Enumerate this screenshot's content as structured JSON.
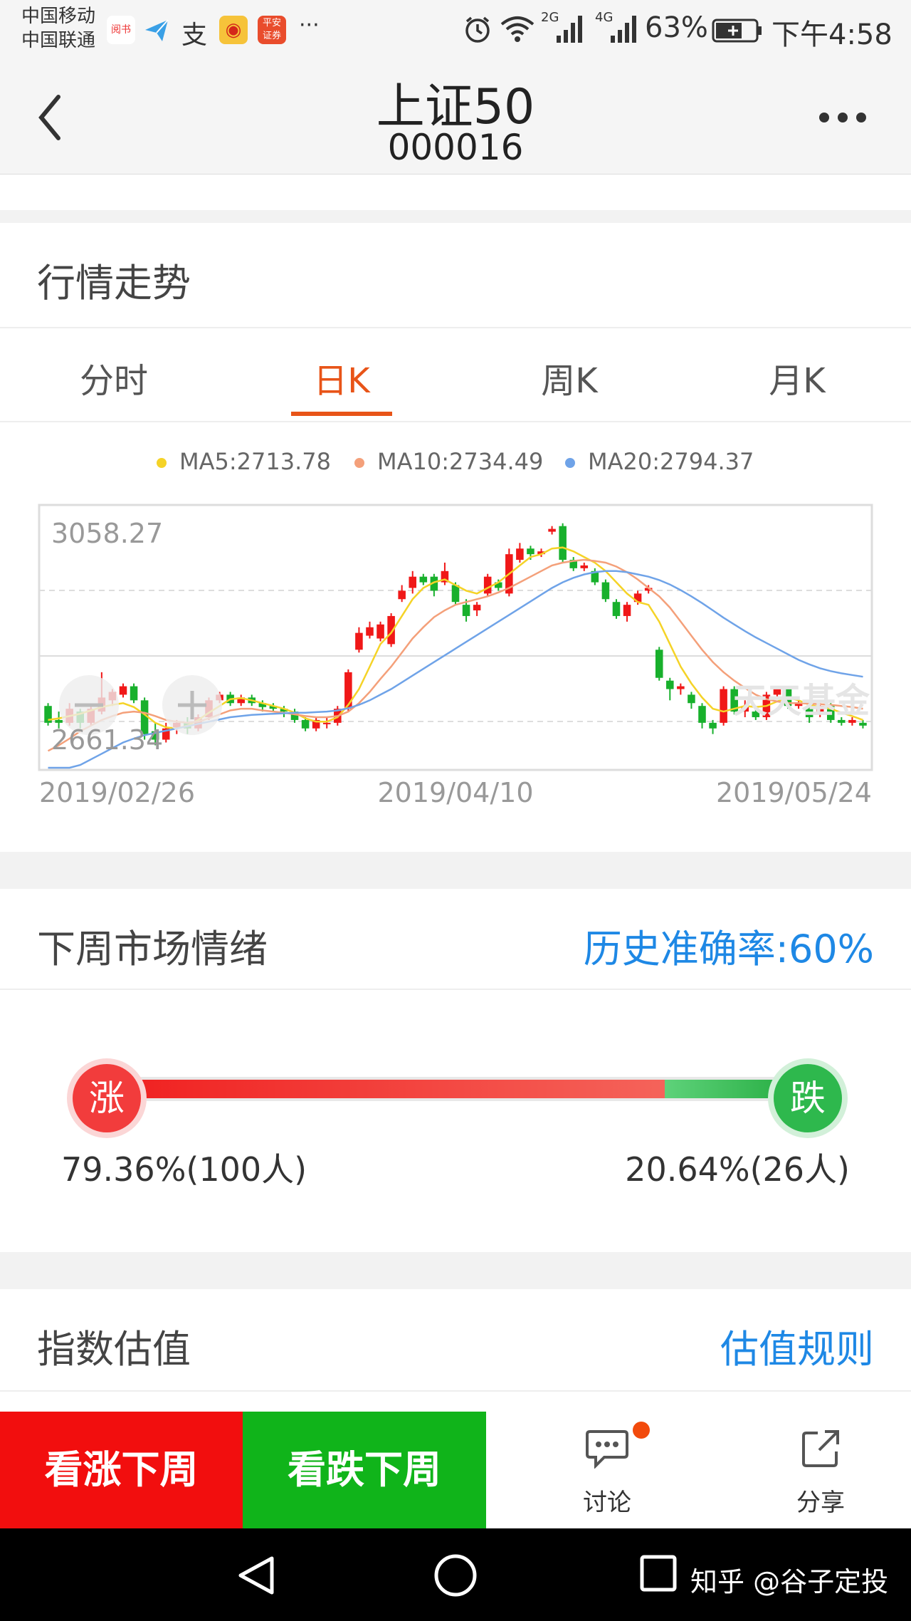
{
  "status_bar": {
    "carrier1": "中国移动",
    "carrier2": "中国联通",
    "app_icons": [
      "阅书",
      "paper-plane",
      "支",
      "weibo",
      "平安证券"
    ],
    "more": "···",
    "network1": "2G",
    "network2": "4G",
    "battery": "63%",
    "time": "下午4:58"
  },
  "header": {
    "title": "上证50",
    "code": "000016"
  },
  "market_trend": {
    "title": "行情走势",
    "tabs": [
      {
        "label": "分时"
      },
      {
        "label": "日K"
      },
      {
        "label": "周K"
      },
      {
        "label": "月K"
      }
    ],
    "active_tab": "日K",
    "legend": [
      {
        "label": "MA5:2713.78",
        "color": "#f5d327"
      },
      {
        "label": "MA10:2734.49",
        "color": "#f4a07a"
      },
      {
        "label": "MA20:2794.37",
        "color": "#6fa3e8"
      }
    ]
  },
  "chart_data": {
    "type": "candlestick",
    "ymax_label": "3058.27",
    "ymin_label": "2661.34",
    "ylim": [
      2620,
      3080
    ],
    "x_tick_labels": [
      "2019/02/26",
      "2019/04/10",
      "2019/05/24"
    ],
    "watermark": "天天基金",
    "up_color": "#f01818",
    "down_color": "#18b02c",
    "candles": [
      [
        2730,
        2700,
        2735,
        2695
      ],
      [
        2705,
        2700,
        2720,
        2690
      ],
      [
        2700,
        2725,
        2735,
        2695
      ],
      [
        2720,
        2700,
        2725,
        2690
      ],
      [
        2700,
        2725,
        2730,
        2695
      ],
      [
        2720,
        2745,
        2790,
        2715
      ],
      [
        2740,
        2755,
        2760,
        2730
      ],
      [
        2750,
        2765,
        2770,
        2745
      ],
      [
        2765,
        2740,
        2770,
        2735
      ],
      [
        2740,
        2680,
        2745,
        2670
      ],
      [
        2685,
        2670,
        2700,
        2660
      ],
      [
        2670,
        2690,
        2700,
        2665
      ],
      [
        2690,
        2700,
        2705,
        2680
      ],
      [
        2700,
        2690,
        2710,
        2680
      ],
      [
        2690,
        2710,
        2715,
        2685
      ],
      [
        2710,
        2740,
        2745,
        2705
      ],
      [
        2740,
        2750,
        2755,
        2735
      ],
      [
        2750,
        2735,
        2755,
        2730
      ],
      [
        2735,
        2745,
        2750,
        2730
      ],
      [
        2745,
        2735,
        2750,
        2730
      ],
      [
        2735,
        2728,
        2740,
        2720
      ],
      [
        2730,
        2725,
        2735,
        2720
      ],
      [
        2725,
        2720,
        2730,
        2710
      ],
      [
        2720,
        2705,
        2725,
        2700
      ],
      [
        2705,
        2690,
        2710,
        2685
      ],
      [
        2690,
        2705,
        2710,
        2685
      ],
      [
        2700,
        2700,
        2710,
        2690
      ],
      [
        2700,
        2725,
        2730,
        2695
      ],
      [
        2725,
        2790,
        2795,
        2720
      ],
      [
        2830,
        2860,
        2870,
        2825
      ],
      [
        2855,
        2870,
        2880,
        2850
      ],
      [
        2850,
        2875,
        2880,
        2845
      ],
      [
        2840,
        2890,
        2895,
        2835
      ],
      [
        2920,
        2935,
        2945,
        2915
      ],
      [
        2940,
        2960,
        2970,
        2930
      ],
      [
        2960,
        2950,
        2965,
        2945
      ],
      [
        2960,
        2935,
        2965,
        2925
      ],
      [
        2950,
        2970,
        2985,
        2945
      ],
      [
        2945,
        2915,
        2950,
        2910
      ],
      [
        2910,
        2890,
        2920,
        2880
      ],
      [
        2900,
        2910,
        2915,
        2890
      ],
      [
        2930,
        2960,
        2965,
        2925
      ],
      [
        2950,
        2940,
        2955,
        2935
      ],
      [
        2930,
        3000,
        3010,
        2925
      ],
      [
        2990,
        3010,
        3020,
        2985
      ],
      [
        3010,
        3000,
        3015,
        2990
      ],
      [
        3000,
        3005,
        3010,
        2995
      ],
      [
        3040,
        3045,
        3050,
        3035
      ],
      [
        3050,
        2990,
        3055,
        2985
      ],
      [
        2990,
        2975,
        2995,
        2970
      ],
      [
        2975,
        2980,
        2985,
        2970
      ],
      [
        2970,
        2950,
        2975,
        2945
      ],
      [
        2950,
        2920,
        2955,
        2915
      ],
      [
        2915,
        2890,
        2920,
        2885
      ],
      [
        2890,
        2910,
        2915,
        2880
      ],
      [
        2915,
        2930,
        2935,
        2910
      ],
      [
        2935,
        2940,
        2945,
        2930
      ],
      [
        2830,
        2780,
        2835,
        2775
      ],
      [
        2775,
        2760,
        2780,
        2740
      ],
      [
        2760,
        2765,
        2770,
        2750
      ],
      [
        2750,
        2735,
        2755,
        2725
      ],
      [
        2730,
        2700,
        2735,
        2690
      ],
      [
        2700,
        2690,
        2705,
        2680
      ],
      [
        2700,
        2760,
        2765,
        2695
      ],
      [
        2760,
        2720,
        2765,
        2715
      ],
      [
        2720,
        2730,
        2740,
        2710
      ],
      [
        2720,
        2710,
        2730,
        2705
      ],
      [
        2710,
        2750,
        2755,
        2705
      ],
      [
        2750,
        2760,
        2765,
        2745
      ],
      [
        2760,
        2730,
        2765,
        2725
      ],
      [
        2730,
        2735,
        2740,
        2725
      ],
      [
        2725,
        2710,
        2730,
        2700
      ],
      [
        2720,
        2730,
        2735,
        2710
      ],
      [
        2730,
        2705,
        2735,
        2700
      ],
      [
        2705,
        2700,
        2710,
        2695
      ],
      [
        2700,
        2705,
        2710,
        2695
      ],
      [
        2700,
        2695,
        2705,
        2690
      ]
    ],
    "ma5": [
      2705,
      2708,
      2712,
      2716,
      2722,
      2728,
      2732,
      2735,
      2728,
      2715,
      2700,
      2692,
      2690,
      2695,
      2705,
      2718,
      2730,
      2742,
      2744,
      2740,
      2735,
      2730,
      2725,
      2718,
      2708,
      2702,
      2702,
      2710,
      2732,
      2760,
      2800,
      2840,
      2860,
      2890,
      2920,
      2940,
      2950,
      2955,
      2945,
      2935,
      2930,
      2940,
      2950,
      2965,
      2980,
      2995,
      3000,
      3010,
      3012,
      3005,
      2995,
      2985,
      2970,
      2950,
      2930,
      2915,
      2910,
      2880,
      2840,
      2800,
      2770,
      2745,
      2725,
      2720,
      2725,
      2730,
      2728,
      2730,
      2738,
      2745,
      2740,
      2732,
      2728,
      2725,
      2718,
      2712,
      2705
    ],
    "ma10": [
      2650,
      2660,
      2672,
      2685,
      2695,
      2705,
      2712,
      2718,
      2720,
      2718,
      2712,
      2705,
      2702,
      2700,
      2702,
      2708,
      2715,
      2722,
      2725,
      2725,
      2722,
      2720,
      2718,
      2715,
      2712,
      2710,
      2710,
      2712,
      2720,
      2735,
      2755,
      2778,
      2800,
      2825,
      2850,
      2870,
      2888,
      2900,
      2910,
      2915,
      2920,
      2925,
      2932,
      2940,
      2950,
      2960,
      2970,
      2980,
      2985,
      2988,
      2990,
      2988,
      2985,
      2978,
      2968,
      2955,
      2940,
      2925,
      2905,
      2880,
      2855,
      2830,
      2808,
      2790,
      2775,
      2762,
      2750,
      2742,
      2738,
      2735,
      2735,
      2734,
      2733,
      2732,
      2730,
      2728,
      2725
    ],
    "ma20": [
      2600,
      2605,
      2615,
      2625,
      2635,
      2645,
      2655,
      2665,
      2672,
      2678,
      2682,
      2686,
      2690,
      2694,
      2698,
      2702,
      2706,
      2710,
      2712,
      2714,
      2715,
      2716,
      2717,
      2718,
      2718,
      2719,
      2720,
      2722,
      2726,
      2732,
      2740,
      2750,
      2760,
      2772,
      2784,
      2796,
      2808,
      2820,
      2832,
      2844,
      2856,
      2868,
      2880,
      2892,
      2904,
      2916,
      2928,
      2940,
      2950,
      2958,
      2964,
      2968,
      2970,
      2970,
      2968,
      2964,
      2960,
      2954,
      2946,
      2936,
      2925,
      2913,
      2900,
      2887,
      2875,
      2863,
      2852,
      2842,
      2832,
      2822,
      2812,
      2804,
      2797,
      2792,
      2788,
      2785,
      2782
    ]
  },
  "sentiment": {
    "title": "下周市场情绪",
    "accuracy_label": "历史准确率:60%",
    "up_label": "涨",
    "down_label": "跌",
    "up_pct_text": "79.36%(100人)",
    "down_pct_text": "20.64%(26人)",
    "up_fraction": 0.7936
  },
  "valuation": {
    "title": "指数估值",
    "rule_link": "估值规则"
  },
  "bottom_bar": {
    "bull_button": "看涨下周",
    "bear_button": "看跌下周",
    "discuss_label": "讨论",
    "share_label": "分享"
  },
  "watermark_text": "知乎 @谷子定投"
}
